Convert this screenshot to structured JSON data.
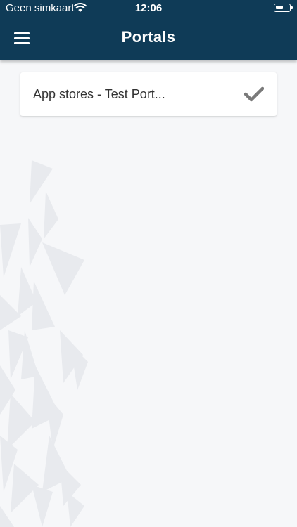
{
  "status_bar": {
    "carrier": "Geen simkaart",
    "time": "12:06",
    "wifi_icon": "wifi-icon",
    "battery_icon": "battery-icon"
  },
  "header": {
    "title": "Portals",
    "menu_icon": "hamburger-menu-icon",
    "background_color": "#0f3b57"
  },
  "portals": {
    "items": [
      {
        "label": "App stores - Test Port...",
        "selected": true,
        "icon": "checkmark-icon"
      }
    ]
  },
  "colors": {
    "page_background": "#f6f7f9",
    "checkmark": "#7a7a7a",
    "decor_triangles": "#e9ebef"
  }
}
